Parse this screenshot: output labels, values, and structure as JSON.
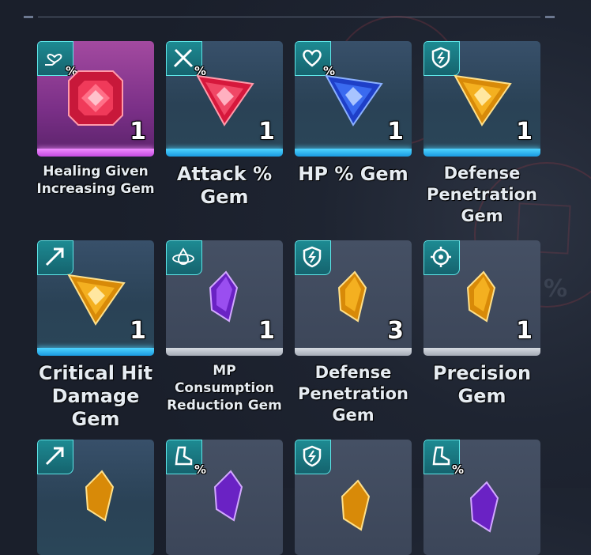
{
  "inventory": {
    "items": [
      {
        "name": "Healing Given Increasing Gem",
        "count": "1",
        "badge": "heart-hand-icon",
        "badge_pct": "%",
        "gem": "ruby-square"
      },
      {
        "name": "Attack % Gem",
        "count": "1",
        "badge": "swords-icon",
        "badge_pct": "%",
        "gem": "ruby-triangle"
      },
      {
        "name": "HP % Gem",
        "count": "1",
        "badge": "heart-icon",
        "badge_pct": "%",
        "gem": "sapphire-triangle"
      },
      {
        "name": "Defense Penetration Gem",
        "count": "1",
        "badge": "shield-break-icon",
        "badge_pct": "",
        "gem": "topaz-triangle"
      },
      {
        "name": "Critical Hit Damage Gem",
        "count": "1",
        "badge": "arrow-icon",
        "badge_pct": "",
        "gem": "topaz-triangle"
      },
      {
        "name": "MP Consumption Reduction Gem",
        "count": "1",
        "badge": "mana-icon",
        "badge_pct": "",
        "gem": "amethyst-shard"
      },
      {
        "name": "Defense Penetration Gem",
        "count": "3",
        "badge": "shield-break-icon",
        "badge_pct": "",
        "gem": "topaz-shard"
      },
      {
        "name": "Precision Gem",
        "count": "1",
        "badge": "crosshair-icon",
        "badge_pct": "",
        "gem": "topaz-shard"
      },
      {
        "badge": "arrow-icon",
        "badge_pct": "",
        "gem": "topaz-shard"
      },
      {
        "badge": "boot-icon",
        "badge_pct": "%",
        "gem": "amethyst-shard"
      },
      {
        "badge": "shield-break-icon",
        "badge_pct": "",
        "gem": "topaz-shard"
      },
      {
        "badge": "boot-icon",
        "badge_pct": "%",
        "gem": "amethyst-shard"
      }
    ]
  },
  "colors": {
    "ruby": "#e8284c",
    "sapphire": "#2a55e0",
    "topaz": "#f0a418",
    "amethyst": "#8a3be0",
    "badge_teal": "#1d8a92"
  }
}
